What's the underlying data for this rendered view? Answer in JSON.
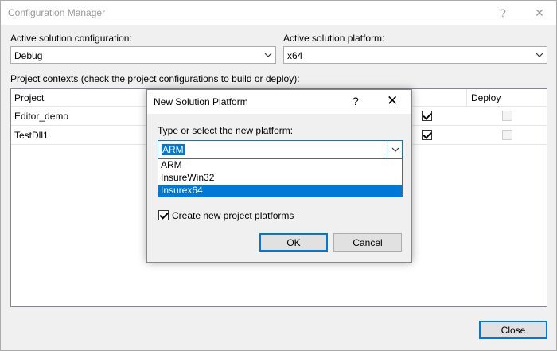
{
  "window": {
    "title": "Configuration Manager",
    "help_glyph": "?",
    "close_glyph": "✕"
  },
  "config": {
    "label": "Active solution configuration:",
    "value": "Debug"
  },
  "platform": {
    "label": "Active solution platform:",
    "value": "x64"
  },
  "contexts": {
    "label": "Project contexts (check the project configurations to build or deploy):",
    "columns": {
      "project": "Project",
      "deploy": "Deploy"
    },
    "rows": [
      {
        "name": "Editor_demo",
        "build": true,
        "deploy": false
      },
      {
        "name": "TestDll1",
        "build": true,
        "deploy": false
      }
    ]
  },
  "close_button": "Close",
  "dialog": {
    "title": "New Solution Platform",
    "help_glyph": "?",
    "close_glyph": "✕",
    "prompt": "Type or select the new platform:",
    "input_value": "ARM",
    "options": [
      "ARM",
      "InsureWin32",
      "Insurex64"
    ],
    "highlighted_option": "Insurex64",
    "create_label": "Create new project platforms",
    "create_checked": true,
    "ok": "OK",
    "cancel": "Cancel"
  },
  "colors": {
    "accent": "#0078d7",
    "background": "#f0f0f0"
  }
}
